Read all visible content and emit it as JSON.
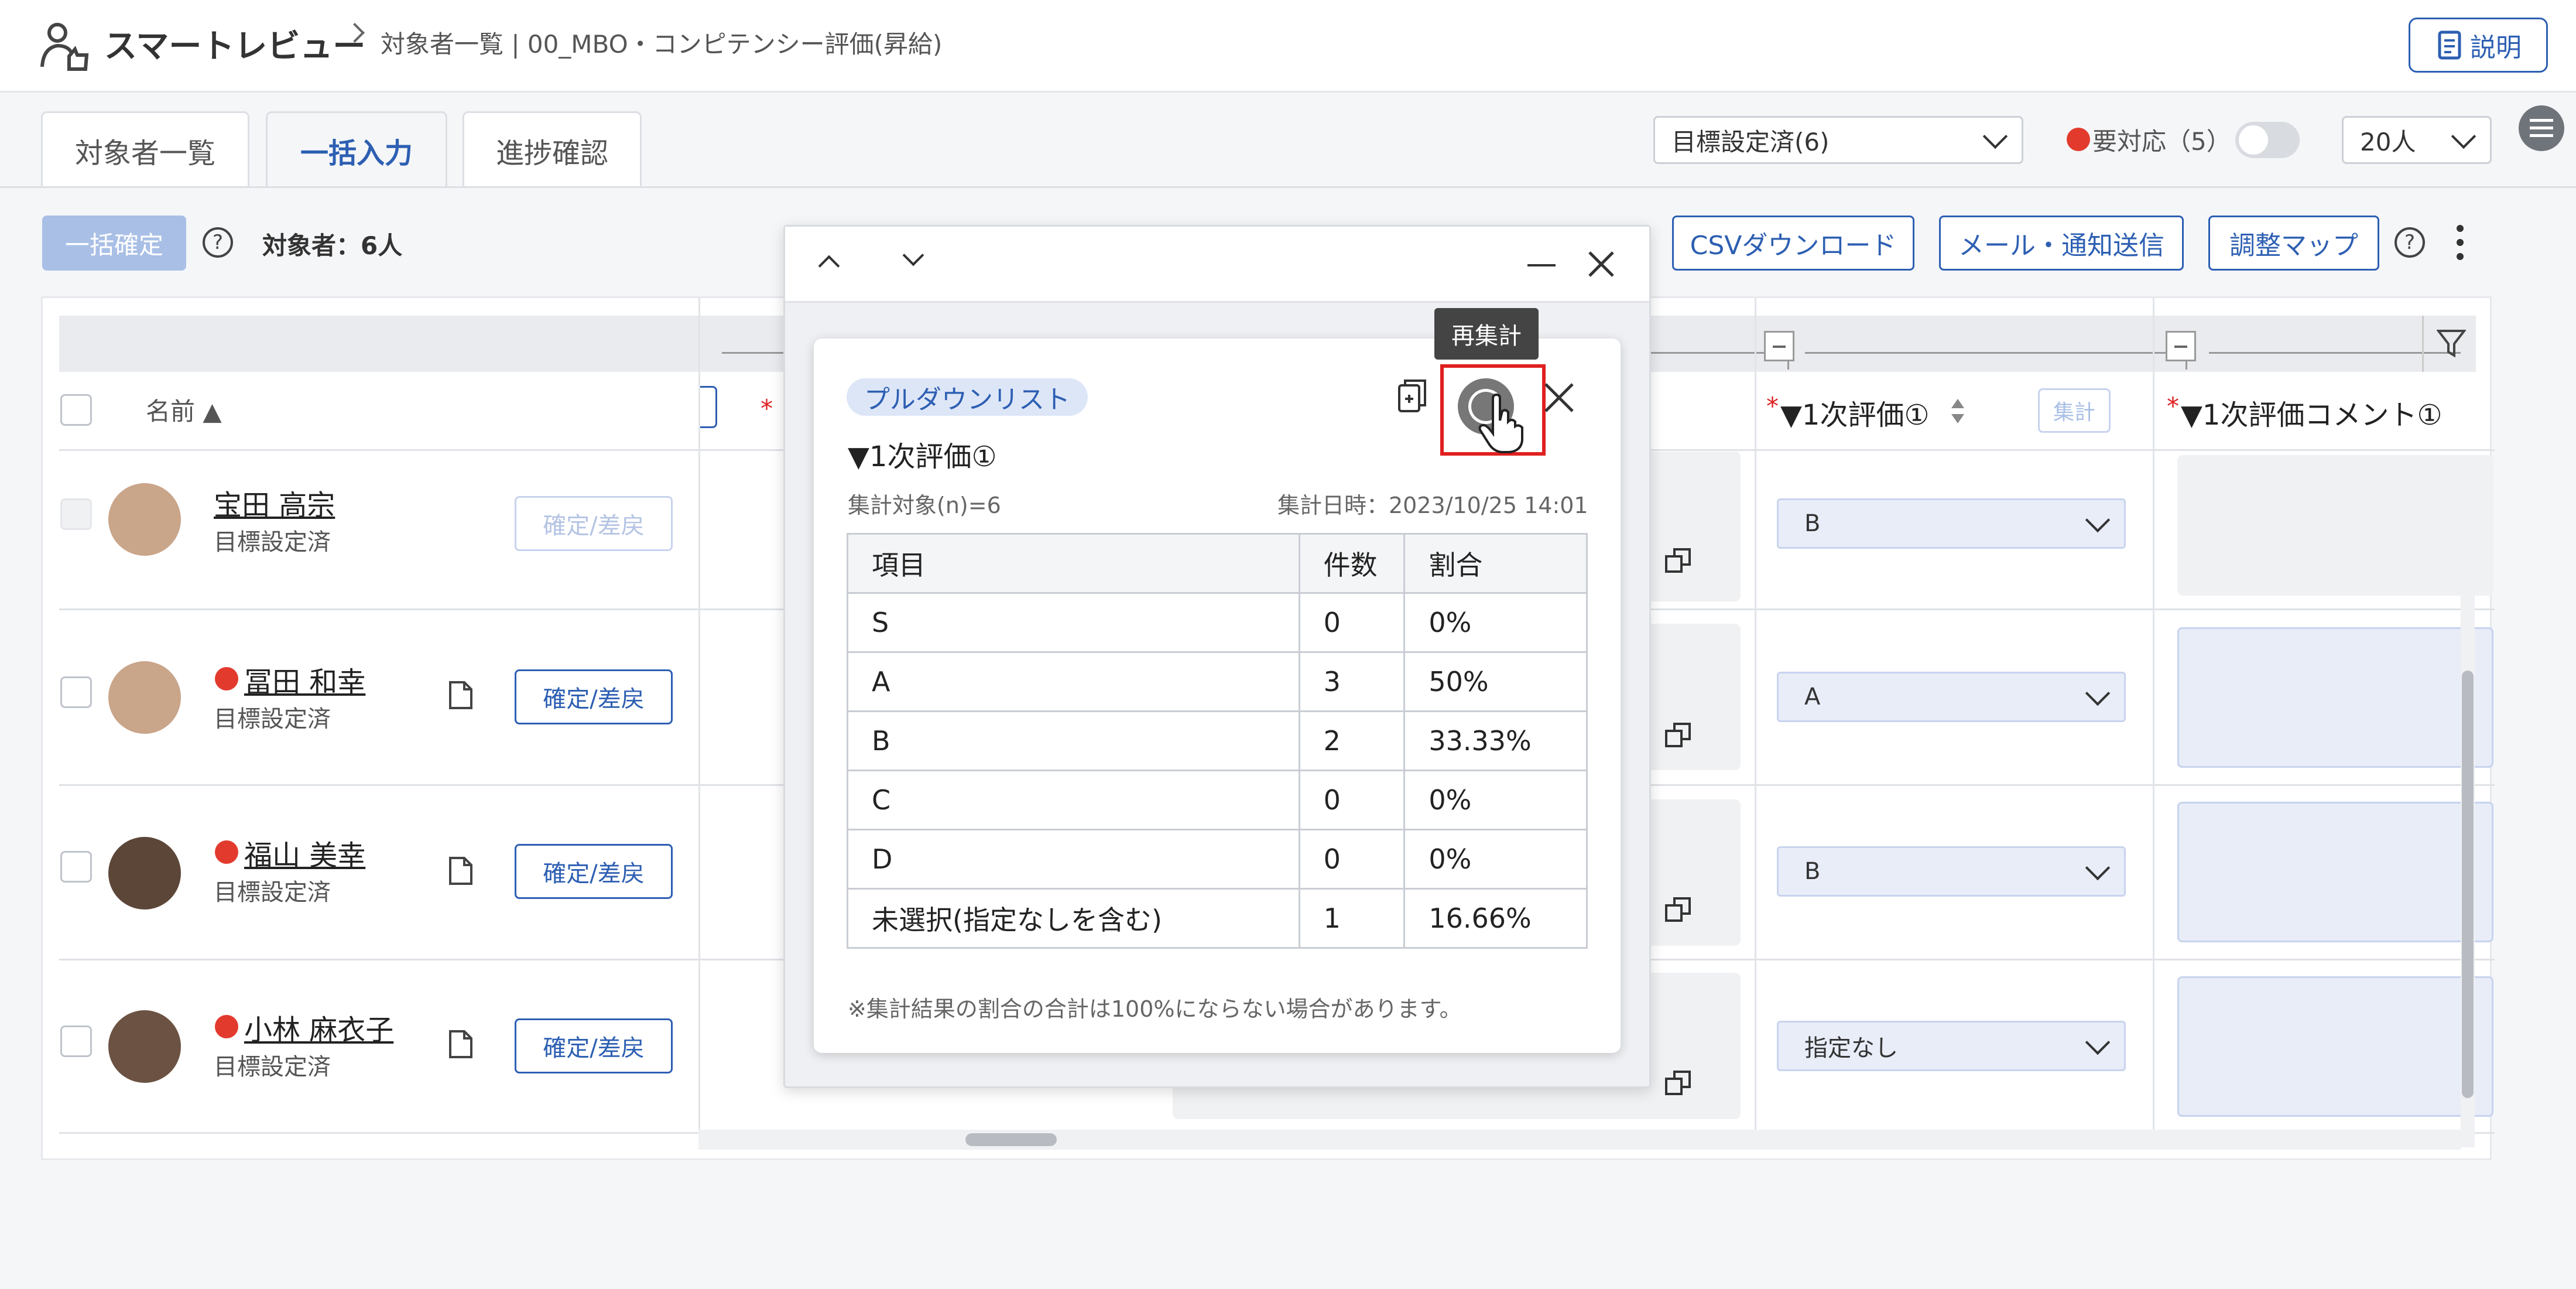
{
  "header": {
    "app_title": "スマートレビュー",
    "breadcrumb": "対象者一覧 | 00_MBO・コンピテンシー評価(昇給)",
    "help_button": "説明"
  },
  "tabs": [
    {
      "label": "対象者一覧",
      "active": false
    },
    {
      "label": "一括入力",
      "active": true
    },
    {
      "label": "進捗確認",
      "active": false
    }
  ],
  "filters": {
    "status_select": "目標設定済(6)",
    "needs_action_label": "要対応（5）",
    "needs_action_toggle": false,
    "page_size": "20人"
  },
  "toolbar": {
    "bulk_confirm": "一括確定",
    "target_count": "対象者：6人",
    "csv_download": "CSVダウンロード",
    "mail_notify": "メール・通知送信",
    "adjust_map": "調整マップ"
  },
  "table": {
    "name_header": "名前 ▲",
    "eval_header": "▼1次評価①",
    "eval_agg_button": "集計",
    "comment_header": "▼1次評価コメント①",
    "required_mark": "*",
    "rows": [
      {
        "name": "宝田 高宗",
        "status": "目標設定済",
        "button": "確定/差戻",
        "alert": false,
        "eval": "B",
        "button_disabled": true
      },
      {
        "name": "冨田 和幸",
        "status": "目標設定済",
        "button": "確定/差戻",
        "alert": true,
        "eval": "A",
        "button_disabled": false
      },
      {
        "name": "福山 美幸",
        "status": "目標設定済",
        "button": "確定/差戻",
        "alert": true,
        "eval": "B",
        "button_disabled": false
      },
      {
        "name": "小林 麻衣子",
        "status": "目標設定済",
        "button": "確定/差戻",
        "alert": true,
        "eval": "指定なし",
        "button_disabled": false
      }
    ]
  },
  "popup": {
    "tag": "プルダウンリスト",
    "title": "▼1次評価①",
    "target": "集計対象(n)=6",
    "timestamp": "集計日時：2023/10/25 14:01",
    "tooltip": "再集計",
    "columns": [
      "項目",
      "件数",
      "割合"
    ],
    "rows": [
      [
        "S",
        "0",
        "0%"
      ],
      [
        "A",
        "3",
        "50%"
      ],
      [
        "B",
        "2",
        "33.33%"
      ],
      [
        "C",
        "0",
        "0%"
      ],
      [
        "D",
        "0",
        "0%"
      ],
      [
        "未選択(指定なしを含む)",
        "1",
        "16.66%"
      ]
    ],
    "note": "※集計結果の割合の合計は100%にならない場合があります。"
  },
  "colors": {
    "accent": "#2d5fb2",
    "alert": "#e23b2e",
    "highlight": "#e02020"
  }
}
